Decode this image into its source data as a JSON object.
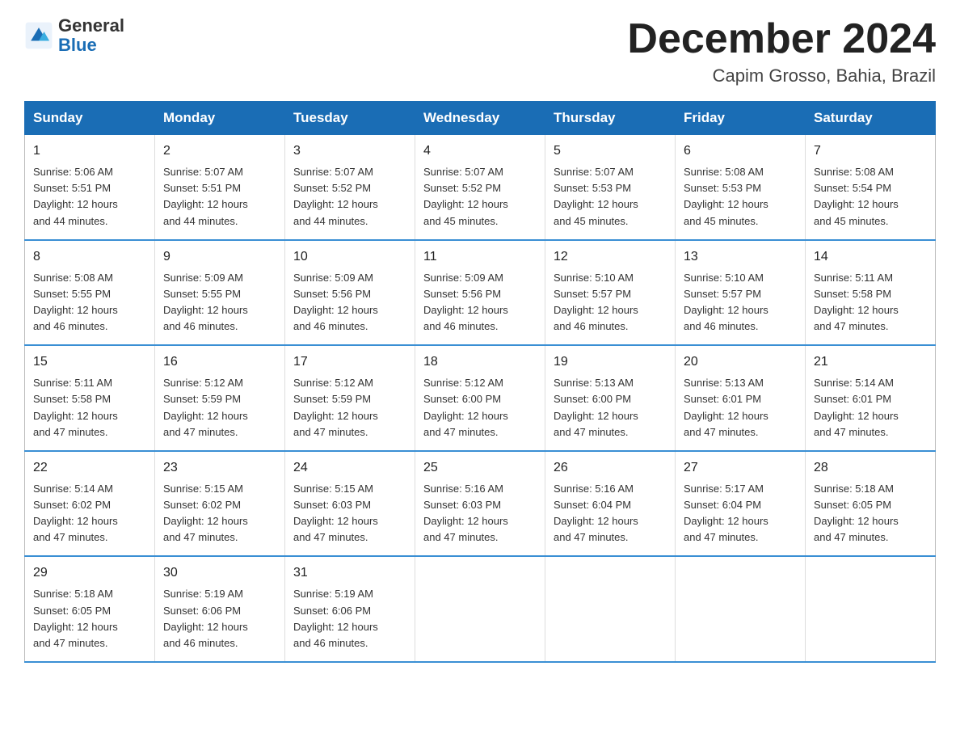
{
  "header": {
    "logo_general": "General",
    "logo_blue": "Blue",
    "month_title": "December 2024",
    "location": "Capim Grosso, Bahia, Brazil"
  },
  "weekdays": [
    "Sunday",
    "Monday",
    "Tuesday",
    "Wednesday",
    "Thursday",
    "Friday",
    "Saturday"
  ],
  "weeks": [
    [
      {
        "day": "1",
        "sunrise": "5:06 AM",
        "sunset": "5:51 PM",
        "daylight": "12 hours and 44 minutes."
      },
      {
        "day": "2",
        "sunrise": "5:07 AM",
        "sunset": "5:51 PM",
        "daylight": "12 hours and 44 minutes."
      },
      {
        "day": "3",
        "sunrise": "5:07 AM",
        "sunset": "5:52 PM",
        "daylight": "12 hours and 44 minutes."
      },
      {
        "day": "4",
        "sunrise": "5:07 AM",
        "sunset": "5:52 PM",
        "daylight": "12 hours and 45 minutes."
      },
      {
        "day": "5",
        "sunrise": "5:07 AM",
        "sunset": "5:53 PM",
        "daylight": "12 hours and 45 minutes."
      },
      {
        "day": "6",
        "sunrise": "5:08 AM",
        "sunset": "5:53 PM",
        "daylight": "12 hours and 45 minutes."
      },
      {
        "day": "7",
        "sunrise": "5:08 AM",
        "sunset": "5:54 PM",
        "daylight": "12 hours and 45 minutes."
      }
    ],
    [
      {
        "day": "8",
        "sunrise": "5:08 AM",
        "sunset": "5:55 PM",
        "daylight": "12 hours and 46 minutes."
      },
      {
        "day": "9",
        "sunrise": "5:09 AM",
        "sunset": "5:55 PM",
        "daylight": "12 hours and 46 minutes."
      },
      {
        "day": "10",
        "sunrise": "5:09 AM",
        "sunset": "5:56 PM",
        "daylight": "12 hours and 46 minutes."
      },
      {
        "day": "11",
        "sunrise": "5:09 AM",
        "sunset": "5:56 PM",
        "daylight": "12 hours and 46 minutes."
      },
      {
        "day": "12",
        "sunrise": "5:10 AM",
        "sunset": "5:57 PM",
        "daylight": "12 hours and 46 minutes."
      },
      {
        "day": "13",
        "sunrise": "5:10 AM",
        "sunset": "5:57 PM",
        "daylight": "12 hours and 46 minutes."
      },
      {
        "day": "14",
        "sunrise": "5:11 AM",
        "sunset": "5:58 PM",
        "daylight": "12 hours and 47 minutes."
      }
    ],
    [
      {
        "day": "15",
        "sunrise": "5:11 AM",
        "sunset": "5:58 PM",
        "daylight": "12 hours and 47 minutes."
      },
      {
        "day": "16",
        "sunrise": "5:12 AM",
        "sunset": "5:59 PM",
        "daylight": "12 hours and 47 minutes."
      },
      {
        "day": "17",
        "sunrise": "5:12 AM",
        "sunset": "5:59 PM",
        "daylight": "12 hours and 47 minutes."
      },
      {
        "day": "18",
        "sunrise": "5:12 AM",
        "sunset": "6:00 PM",
        "daylight": "12 hours and 47 minutes."
      },
      {
        "day": "19",
        "sunrise": "5:13 AM",
        "sunset": "6:00 PM",
        "daylight": "12 hours and 47 minutes."
      },
      {
        "day": "20",
        "sunrise": "5:13 AM",
        "sunset": "6:01 PM",
        "daylight": "12 hours and 47 minutes."
      },
      {
        "day": "21",
        "sunrise": "5:14 AM",
        "sunset": "6:01 PM",
        "daylight": "12 hours and 47 minutes."
      }
    ],
    [
      {
        "day": "22",
        "sunrise": "5:14 AM",
        "sunset": "6:02 PM",
        "daylight": "12 hours and 47 minutes."
      },
      {
        "day": "23",
        "sunrise": "5:15 AM",
        "sunset": "6:02 PM",
        "daylight": "12 hours and 47 minutes."
      },
      {
        "day": "24",
        "sunrise": "5:15 AM",
        "sunset": "6:03 PM",
        "daylight": "12 hours and 47 minutes."
      },
      {
        "day": "25",
        "sunrise": "5:16 AM",
        "sunset": "6:03 PM",
        "daylight": "12 hours and 47 minutes."
      },
      {
        "day": "26",
        "sunrise": "5:16 AM",
        "sunset": "6:04 PM",
        "daylight": "12 hours and 47 minutes."
      },
      {
        "day": "27",
        "sunrise": "5:17 AM",
        "sunset": "6:04 PM",
        "daylight": "12 hours and 47 minutes."
      },
      {
        "day": "28",
        "sunrise": "5:18 AM",
        "sunset": "6:05 PM",
        "daylight": "12 hours and 47 minutes."
      }
    ],
    [
      {
        "day": "29",
        "sunrise": "5:18 AM",
        "sunset": "6:05 PM",
        "daylight": "12 hours and 47 minutes."
      },
      {
        "day": "30",
        "sunrise": "5:19 AM",
        "sunset": "6:06 PM",
        "daylight": "12 hours and 46 minutes."
      },
      {
        "day": "31",
        "sunrise": "5:19 AM",
        "sunset": "6:06 PM",
        "daylight": "12 hours and 46 minutes."
      },
      null,
      null,
      null,
      null
    ]
  ],
  "labels": {
    "sunrise": "Sunrise:",
    "sunset": "Sunset:",
    "daylight": "Daylight:"
  }
}
